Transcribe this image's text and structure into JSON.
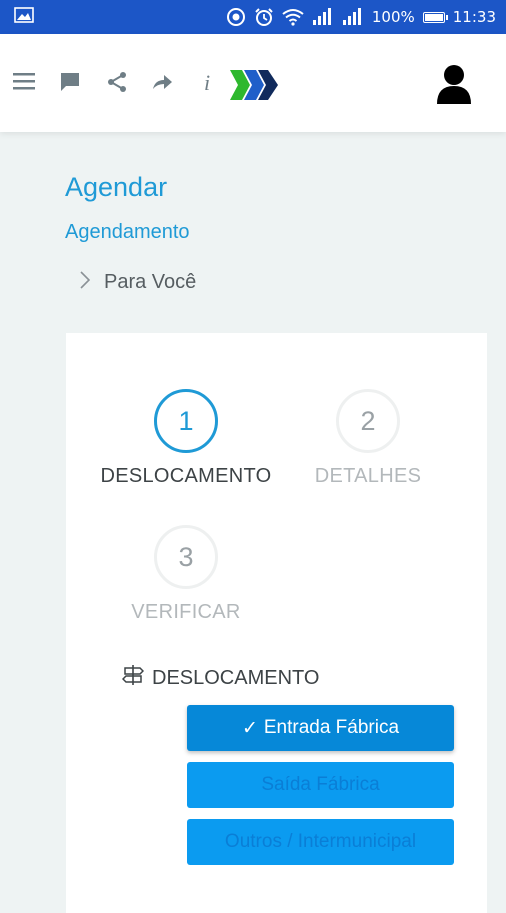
{
  "status_bar": {
    "battery": "100%",
    "time": "11:33"
  },
  "header": {
    "icons": [
      "menu-icon",
      "chat-icon",
      "share-icon",
      "forward-icon",
      "info-icon",
      "brand-logo",
      "user-icon"
    ],
    "info_glyph": "i"
  },
  "page": {
    "title": "Agendar",
    "link": "Agendamento",
    "breadcrumb": "Para Você"
  },
  "steps": [
    {
      "number": "1",
      "label": "DESLOCAMENTO",
      "active": true
    },
    {
      "number": "2",
      "label": "DETALHES",
      "active": false
    },
    {
      "number": "3",
      "label": "VERIFICAR",
      "active": false
    }
  ],
  "section": {
    "title": "DESLOCAMENTO"
  },
  "options": [
    {
      "label": "Entrada Fábrica",
      "selected": true,
      "check": "✓"
    },
    {
      "label": "Saída Fábrica",
      "selected": false
    },
    {
      "label": "Outros / Intermunicipal",
      "selected": false
    }
  ],
  "colors": {
    "status_bar": "#1c56c7",
    "accent": "#1f9ad6",
    "button": "#0b9bf0",
    "button_selected": "#0688d8",
    "logo_green": "#2eb82e",
    "logo_blue": "#1f5fc9",
    "logo_navy": "#102a5c"
  }
}
